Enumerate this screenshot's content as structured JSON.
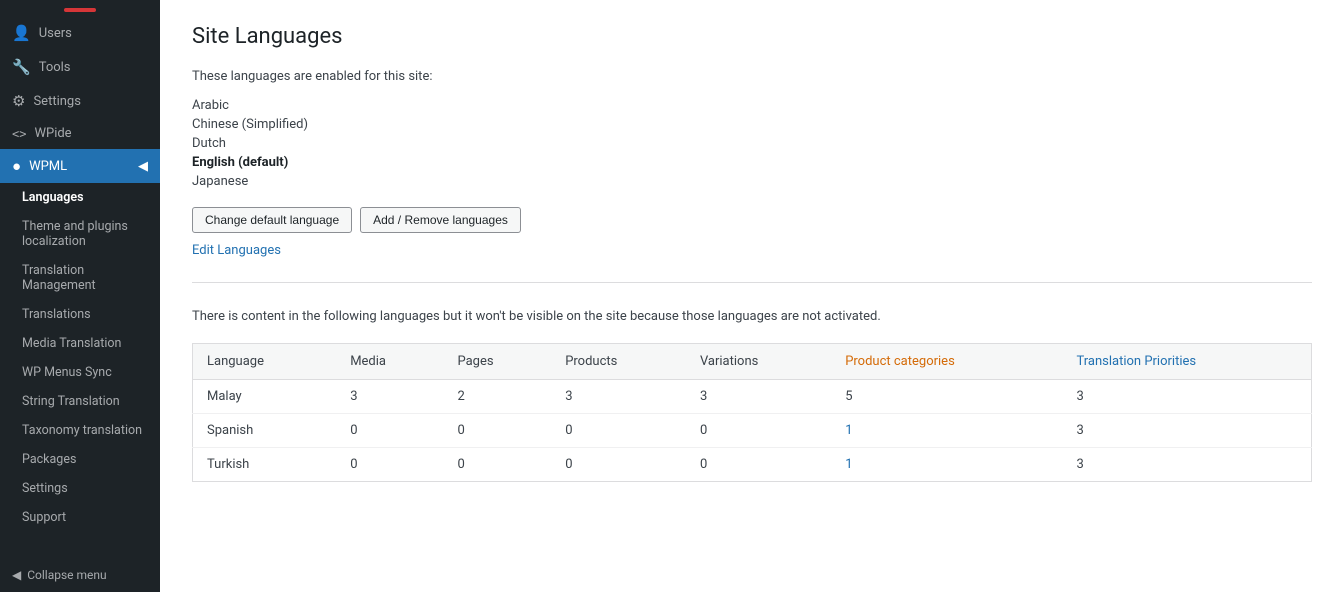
{
  "sidebar": {
    "items": [
      {
        "label": "Users",
        "icon": "👤",
        "name": "users"
      },
      {
        "label": "Tools",
        "icon": "🔧",
        "name": "tools"
      },
      {
        "label": "Settings",
        "icon": "⚙",
        "name": "settings"
      },
      {
        "label": "WPide",
        "icon": "<>",
        "name": "wpide"
      },
      {
        "label": "WPML",
        "icon": "●",
        "name": "wpml",
        "active": true
      }
    ],
    "submenu": [
      {
        "label": "Languages",
        "name": "languages",
        "active": true
      },
      {
        "label": "Theme and plugins localization",
        "name": "theme-plugins"
      },
      {
        "label": "Translation Management",
        "name": "translation-management"
      },
      {
        "label": "Translations",
        "name": "translations"
      },
      {
        "label": "Media Translation",
        "name": "media-translation"
      },
      {
        "label": "WP Menus Sync",
        "name": "wp-menus-sync"
      },
      {
        "label": "String Translation",
        "name": "string-translation"
      },
      {
        "label": "Taxonomy translation",
        "name": "taxonomy-translation"
      },
      {
        "label": "Packages",
        "name": "packages"
      },
      {
        "label": "Settings",
        "name": "wpml-settings"
      },
      {
        "label": "Support",
        "name": "support"
      }
    ],
    "collapse_label": "Collapse menu"
  },
  "main": {
    "page_title": "Site Languages",
    "section1": {
      "intro": "These languages are enabled for this site:",
      "languages": [
        {
          "label": "Arabic",
          "bold": false
        },
        {
          "label": "Chinese (Simplified)",
          "bold": false
        },
        {
          "label": "Dutch",
          "bold": false
        },
        {
          "label": "English (default)",
          "bold": true
        },
        {
          "label": "Japanese",
          "bold": false
        }
      ],
      "btn_change": "Change default language",
      "btn_add": "Add / Remove languages",
      "link_edit": "Edit Languages"
    },
    "section2": {
      "warning": "There is content in the following languages but it won't be visible on the site because those languages are not activated.",
      "table": {
        "headers": [
          {
            "label": "Language",
            "class": ""
          },
          {
            "label": "Media",
            "class": ""
          },
          {
            "label": "Pages",
            "class": ""
          },
          {
            "label": "Products",
            "class": ""
          },
          {
            "label": "Variations",
            "class": ""
          },
          {
            "label": "Product categories",
            "class": "accent"
          },
          {
            "label": "Translation Priorities",
            "class": "blue"
          }
        ],
        "rows": [
          {
            "language": "Malay",
            "media": "3",
            "pages": "2",
            "products": "3",
            "variations": "3",
            "product_categories": "5",
            "translation_priorities": "3",
            "cat_link": false,
            "pri_link": false
          },
          {
            "language": "Spanish",
            "media": "0",
            "pages": "0",
            "products": "0",
            "variations": "0",
            "product_categories": "1",
            "translation_priorities": "3",
            "cat_link": true,
            "pri_link": false
          },
          {
            "language": "Turkish",
            "media": "0",
            "pages": "0",
            "products": "0",
            "variations": "0",
            "product_categories": "1",
            "translation_priorities": "3",
            "cat_link": true,
            "pri_link": false
          }
        ]
      }
    }
  }
}
